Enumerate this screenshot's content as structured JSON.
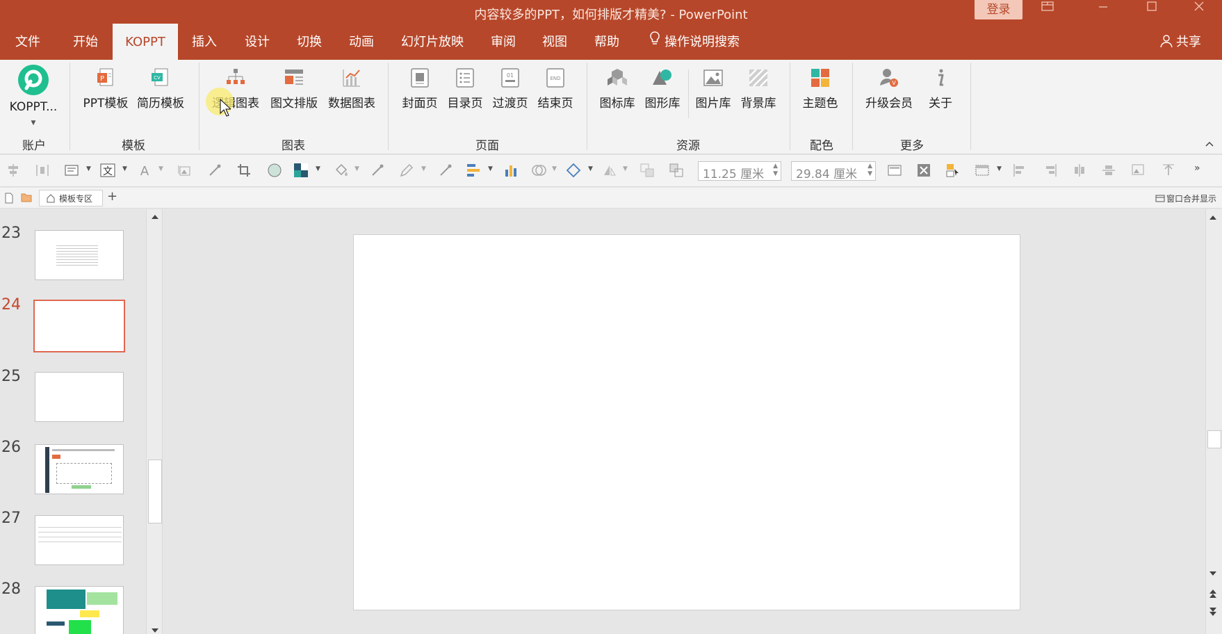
{
  "window": {
    "title": "内容较多的PPT，如何排版才精美?  -  PowerPoint",
    "login_label": "登录",
    "controls": [
      "restore-ribbon",
      "minimize",
      "maximize",
      "close"
    ]
  },
  "tabs": [
    "文件",
    "开始",
    "KOPPT",
    "插入",
    "设计",
    "切换",
    "动画",
    "幻灯片放映",
    "审阅",
    "视图",
    "帮助",
    "操作说明搜索"
  ],
  "active_tab": "KOPPT",
  "share_label": "共享",
  "ribbon": {
    "groups": [
      {
        "label": "账户",
        "buttons": [
          {
            "label": "KOPPT...",
            "icon": "koppt-logo-icon"
          }
        ]
      },
      {
        "label": "模板",
        "buttons": [
          {
            "label": "PPT模板",
            "icon": "ppt-template-icon"
          },
          {
            "label": "简历模板",
            "icon": "resume-template-icon"
          }
        ]
      },
      {
        "label": "图表",
        "buttons": [
          {
            "label": "逻辑图表",
            "icon": "logic-chart-icon"
          },
          {
            "label": "图文排版",
            "icon": "image-text-layout-icon"
          },
          {
            "label": "数据图表",
            "icon": "data-chart-icon"
          }
        ]
      },
      {
        "label": "页面",
        "buttons": [
          {
            "label": "封面页",
            "icon": "cover-page-icon"
          },
          {
            "label": "目录页",
            "icon": "toc-page-icon"
          },
          {
            "label": "过渡页",
            "icon": "transition-page-icon"
          },
          {
            "label": "结束页",
            "icon": "end-page-icon"
          }
        ]
      },
      {
        "label": "资源",
        "buttons": [
          {
            "label": "图标库",
            "icon": "icon-library-icon"
          },
          {
            "label": "图形库",
            "icon": "shape-library-icon"
          },
          {
            "label": "图片库",
            "icon": "picture-library-icon"
          },
          {
            "label": "背景库",
            "icon": "background-library-icon"
          }
        ]
      },
      {
        "label": "配色",
        "buttons": [
          {
            "label": "主题色",
            "icon": "theme-color-icon"
          }
        ]
      },
      {
        "label": "更多",
        "buttons": [
          {
            "label": "升级会员",
            "icon": "upgrade-member-icon"
          },
          {
            "label": "关于",
            "icon": "about-icon"
          }
        ]
      }
    ]
  },
  "size_fields": {
    "height": "11.25 厘米",
    "width": "29.84 厘米"
  },
  "doc_tabs": {
    "template_zone": "模板专区",
    "add": "+",
    "merge_display": "窗口合并显示"
  },
  "slides": {
    "numbers": [
      "23",
      "24",
      "25",
      "26",
      "27",
      "28"
    ],
    "current": "24"
  },
  "colors": {
    "accent": "#b7472a",
    "ribbon_bg": "#f3f3f3",
    "selected_thumb": "#e0674f",
    "logo": "#1fbf8f"
  }
}
